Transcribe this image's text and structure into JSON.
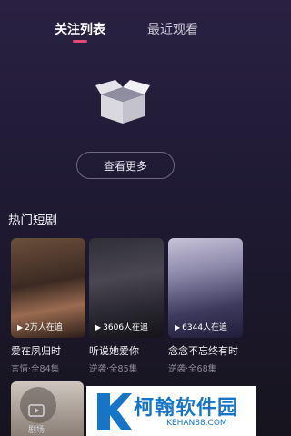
{
  "tabs": {
    "following": "关注列表",
    "recent": "最近观看"
  },
  "empty_state": {
    "button_label": "查看更多"
  },
  "section": {
    "title": "热门短剧"
  },
  "dramas": [
    {
      "title": "爱在夙归时",
      "views": "2万人在追",
      "genre": "言情",
      "episodes": "全84集"
    },
    {
      "title": "听说她爱你",
      "views": "3606人在追",
      "genre": "逆袭",
      "episodes": "全85集"
    },
    {
      "title": "念念不忘终有时",
      "views": "6344人在追",
      "genre": "逆袭",
      "episodes": "全68集"
    }
  ],
  "nav": {
    "item_label": "剧场"
  },
  "watermark": {
    "brand": "柯翰软件园",
    "url": "KEHAN88.COM"
  },
  "colors": {
    "accent": "#e9467a",
    "background": "#1f1a33",
    "watermark_blue": "#1675c9"
  }
}
